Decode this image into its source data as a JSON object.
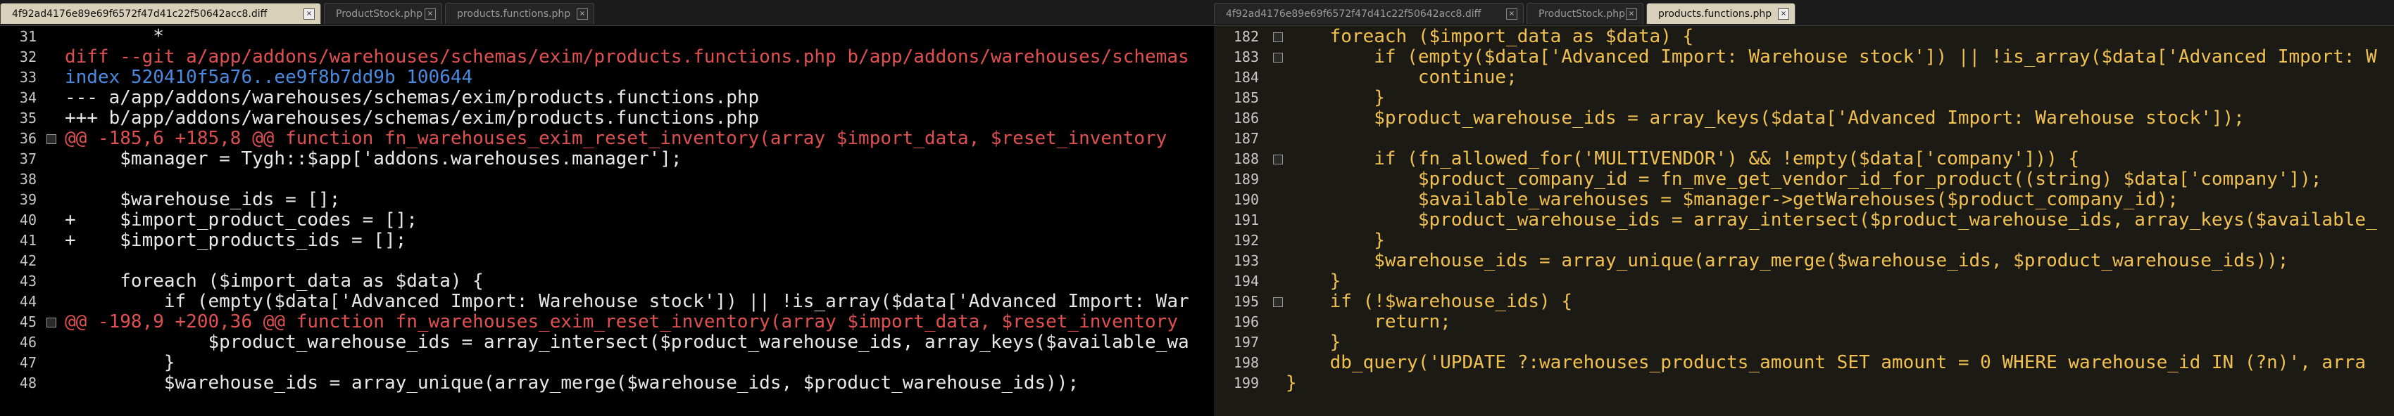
{
  "left": {
    "tabs": [
      {
        "label": "4f92ad4176e89e69f6572f47d41c22f50642acc8.diff",
        "close": "×"
      },
      {
        "label": "ProductStock.php",
        "close": "×"
      },
      {
        "label": "products.functions.php",
        "close": "×"
      }
    ],
    "active_tab": 0,
    "lines": [
      {
        "n": "31",
        "text": "        *"
      },
      {
        "n": "32",
        "text": "diff --git a/app/addons/warehouses/schemas/exim/products.functions.php b/app/addons/warehouses/schemas"
      },
      {
        "n": "33",
        "text": "index 520410f5a76..ee9f8b7dd9b 100644"
      },
      {
        "n": "34",
        "text": "--- a/app/addons/warehouses/schemas/exim/products.functions.php"
      },
      {
        "n": "35",
        "text": "+++ b/app/addons/warehouses/schemas/exim/products.functions.php"
      },
      {
        "n": "36",
        "text": "@@ -185,6 +185,8 @@ function fn_warehouses_exim_reset_inventory(array $import_data, $reset_inventory"
      },
      {
        "n": "37",
        "text": "     $manager = Tygh::$app['addons.warehouses.manager'];"
      },
      {
        "n": "38",
        "text": ""
      },
      {
        "n": "39",
        "text": "     $warehouse_ids = [];"
      },
      {
        "n": "40",
        "text": "+    $import_product_codes = [];"
      },
      {
        "n": "41",
        "text": "+    $import_products_ids = [];"
      },
      {
        "n": "42",
        "text": ""
      },
      {
        "n": "43",
        "text": "     foreach ($import_data as $data) {"
      },
      {
        "n": "44",
        "text": "         if (empty($data['Advanced Import: Warehouse stock']) || !is_array($data['Advanced Import: War"
      },
      {
        "n": "45",
        "text": "@@ -198,9 +200,36 @@ function fn_warehouses_exim_reset_inventory(array $import_data, $reset_inventory"
      },
      {
        "n": "46",
        "text": "             $product_warehouse_ids = array_intersect($product_warehouse_ids, array_keys($available_wa"
      },
      {
        "n": "47",
        "text": "         }"
      },
      {
        "n": "48",
        "text": "         $warehouse_ids = array_unique(array_merge($warehouse_ids, $product_warehouse_ids));"
      }
    ]
  },
  "right": {
    "tabs": [
      {
        "label": "4f92ad4176e89e69f6572f47d41c22f50642acc8.diff",
        "close": "×"
      },
      {
        "label": "ProductStock.php",
        "close": "×"
      },
      {
        "label": "products.functions.php",
        "close": "×"
      }
    ],
    "active_tab": 2,
    "lines": [
      {
        "n": "182",
        "text": "    foreach ($import_data as $data) {"
      },
      {
        "n": "183",
        "text": "        if (empty($data['Advanced Import: Warehouse stock']) || !is_array($data['Advanced Import: W"
      },
      {
        "n": "184",
        "text": "            continue;"
      },
      {
        "n": "185",
        "text": "        }"
      },
      {
        "n": "186",
        "text": "        $product_warehouse_ids = array_keys($data['Advanced Import: Warehouse stock']);"
      },
      {
        "n": "187",
        "text": ""
      },
      {
        "n": "188",
        "text": "        if (fn_allowed_for('MULTIVENDOR') && !empty($data['company'])) {"
      },
      {
        "n": "189",
        "text": "            $product_company_id = fn_mve_get_vendor_id_for_product((string) $data['company']);"
      },
      {
        "n": "190",
        "text": "            $available_warehouses = $manager->getWarehouses($product_company_id);"
      },
      {
        "n": "191",
        "text": "            $product_warehouse_ids = array_intersect($product_warehouse_ids, array_keys($available_"
      },
      {
        "n": "192",
        "text": "        }"
      },
      {
        "n": "193",
        "text": "        $warehouse_ids = array_unique(array_merge($warehouse_ids, $product_warehouse_ids));"
      },
      {
        "n": "194",
        "text": "    }"
      },
      {
        "n": "195",
        "text": "    if (!$warehouse_ids) {"
      },
      {
        "n": "196",
        "text": "        return;"
      },
      {
        "n": "197",
        "text": "    }"
      },
      {
        "n": "198",
        "text": "    db_query('UPDATE ?:warehouses_products_amount SET amount = 0 WHERE warehouse_id IN (?n)', arra"
      },
      {
        "n": "199",
        "text": "}"
      }
    ]
  },
  "colors": {
    "diff_header": "#e05050",
    "index": "#4a8ae0",
    "keyword": "#f5a623",
    "string": "#89c54a",
    "variable": "#e8c870"
  },
  "icons": {
    "tab_close": "close-icon",
    "fold": "fold-marker-icon"
  }
}
